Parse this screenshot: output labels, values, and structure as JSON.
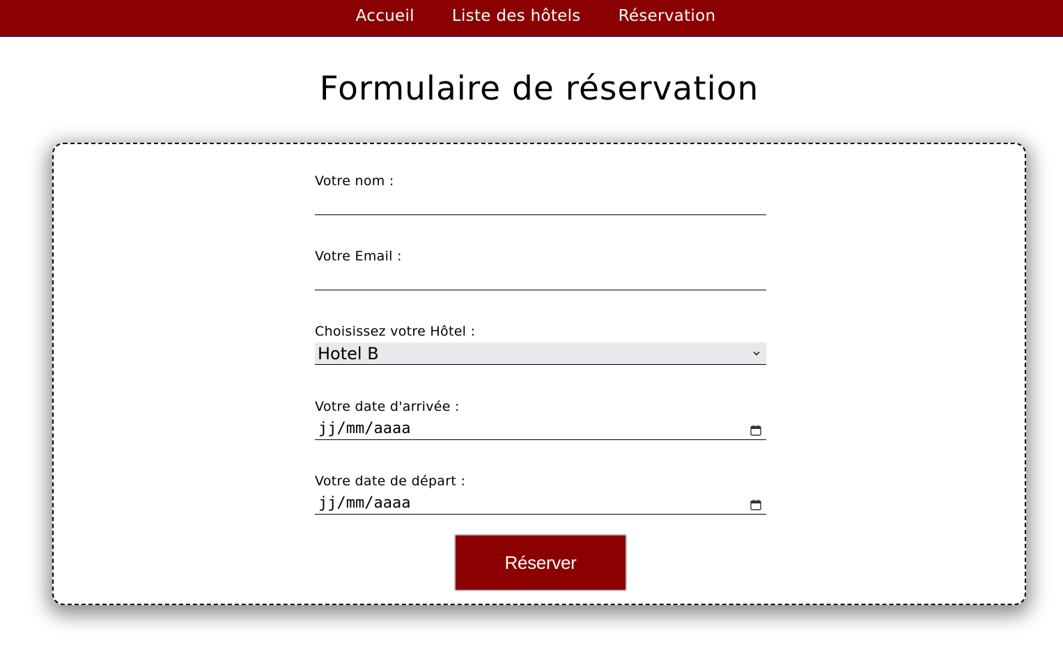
{
  "nav": {
    "items": [
      {
        "label": "Accueil"
      },
      {
        "label": "Liste des hôtels"
      },
      {
        "label": "Réservation"
      }
    ]
  },
  "page": {
    "title": "Formulaire de réservation"
  },
  "form": {
    "name": {
      "label": "Votre nom :",
      "value": ""
    },
    "email": {
      "label": "Votre Email :",
      "value": ""
    },
    "hotel": {
      "label": "Choisissez votre Hôtel :",
      "selected": "Hotel B"
    },
    "arrival": {
      "label": "Votre date d'arrivée :",
      "placeholder": "jj/mm/aaaa"
    },
    "departure": {
      "label": "Votre date de départ :",
      "placeholder": "jj/mm/aaaa"
    },
    "submit_label": "Réserver"
  },
  "colors": {
    "brand": "#8b0000",
    "select_bg": "#e8e8ed"
  },
  "icons": {
    "select": "chevron-down-icon",
    "date": "calendar-icon"
  }
}
